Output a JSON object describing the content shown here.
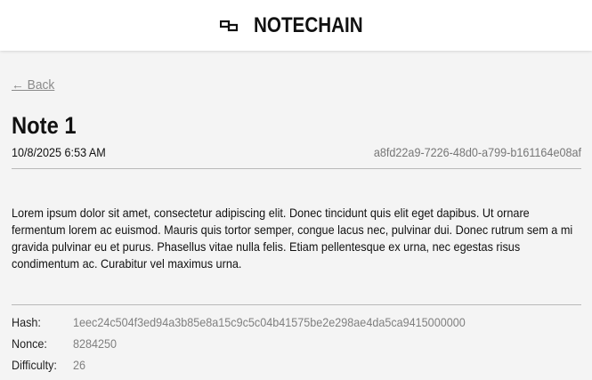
{
  "header": {
    "app_name": "NOTECHAIN",
    "logo_icon": "chain-link-icon"
  },
  "nav": {
    "back_label": "← Back"
  },
  "note": {
    "title": "Note 1",
    "timestamp": "10/8/2025 6:53 AM",
    "id": "a8fd22a9-7226-48d0-a799-b161164e08af",
    "body": "Lorem ipsum dolor sit amet, consectetur adipiscing elit. Donec tincidunt quis elit eget dapibus. Ut ornare fermentum lorem ac euismod. Mauris quis tortor semper, congue lacus nec, pulvinar dui. Donec rutrum sem a mi gravida pulvinar eu et purus. Phasellus vitae nulla felis. Etiam pellentesque ex urna, nec egestas risus condimentum ac. Curabitur vel maximus urna."
  },
  "block": {
    "hash_label": "Hash:",
    "hash_value": "1eec24c504f3ed94a3b85e8a15c9c5c04b41575be2e298ae4da5ca9415000000",
    "nonce_label": "Nonce:",
    "nonce_value": "8284250",
    "difficulty_label": "Difficulty:",
    "difficulty_value": "26"
  },
  "colors": {
    "page_background": "#f4f4f4",
    "header_background": "#ffffff",
    "muted_text": "#808080",
    "divider": "#b9b9b9"
  }
}
